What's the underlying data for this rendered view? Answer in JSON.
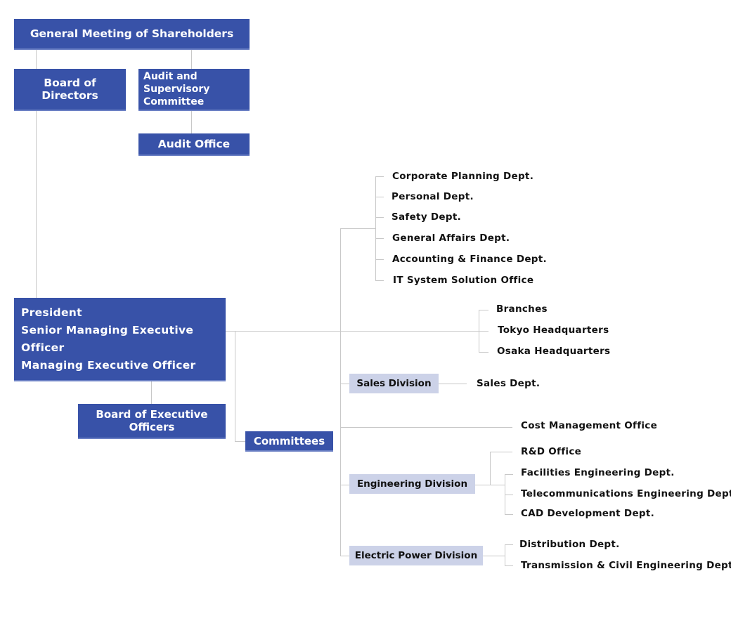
{
  "colors": {
    "primary_box": "#3852a8",
    "division_box": "#ccd2e8",
    "connector": "#c8c8c8",
    "text_dark": "#111111"
  },
  "top": {
    "shareholders": "General Meeting of Shareholders",
    "board_of_directors": "Board of Directors",
    "audit_committee_line1": "Audit and Supervisory",
    "audit_committee_line2": "Committee",
    "audit_office": "Audit Office"
  },
  "executive": {
    "line1": "President",
    "line2": "Senior Managing Executive Officer",
    "line3": "Managing Executive Officer",
    "board_of_executive_officers": "Board of Executive Officers",
    "committees": "Committees"
  },
  "corporate_depts": [
    "Corporate Planning Dept.",
    "Personal Dept.",
    "Safety Dept.",
    "General Affairs Dept.",
    "Accounting & Finance Dept.",
    "IT System Solution Office"
  ],
  "branches": [
    "Branches",
    "Tokyo Headquarters",
    "Osaka Headquarters"
  ],
  "sales": {
    "division": "Sales Division",
    "depts": [
      "Sales Dept."
    ]
  },
  "cost_management": "Cost Management Office",
  "engineering": {
    "division": "Engineering Division",
    "office": "R&D Office",
    "depts": [
      "Facilities Engineering Dept.",
      "Telecommunications Engineering Dept.",
      "CAD Development Dept."
    ]
  },
  "electric_power": {
    "division": "Electric Power Division",
    "depts": [
      "Distribution Dept.",
      "Transmission & Civil Engineering Dept."
    ]
  }
}
